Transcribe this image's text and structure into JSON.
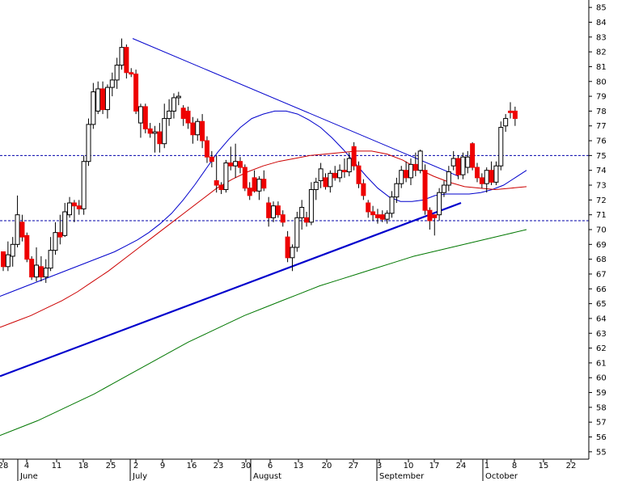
{
  "chart_data": {
    "type": "candlestick",
    "y_axis": {
      "min": 54.5,
      "max": 85.5,
      "ticks": [
        55,
        56,
        57,
        58,
        59,
        60,
        61,
        62,
        63,
        64,
        65,
        66,
        67,
        68,
        69,
        70,
        71,
        72,
        73,
        74,
        75,
        76,
        77,
        78,
        79,
        80,
        81,
        82,
        83,
        84,
        85
      ],
      "position": "right"
    },
    "x_axis": {
      "day_ticks": [
        "28",
        "4",
        "11",
        "18",
        "25",
        "2",
        "9",
        "16",
        "23",
        "30",
        "6",
        "13",
        "20",
        "27",
        "3",
        "10",
        "17",
        "24",
        "1",
        "8",
        "15",
        "22"
      ],
      "months": [
        "June",
        "July",
        "August",
        "September",
        "October"
      ]
    },
    "candles": [
      {
        "o": 68.5,
        "h": 68.5,
        "l": 67.2,
        "c": 67.5,
        "up": false
      },
      {
        "o": 67.5,
        "h": 69.2,
        "l": 67.2,
        "c": 68.3,
        "up": true
      },
      {
        "o": 68.2,
        "h": 69.5,
        "l": 67.5,
        "c": 69.0,
        "up": true
      },
      {
        "o": 69.0,
        "h": 72.3,
        "l": 68.8,
        "c": 71.0,
        "up": true
      },
      {
        "o": 70.5,
        "h": 71.0,
        "l": 69.2,
        "c": 69.5,
        "up": false
      },
      {
        "o": 69.6,
        "h": 69.8,
        "l": 67.8,
        "c": 68.0,
        "up": false
      },
      {
        "o": 68.0,
        "h": 68.2,
        "l": 66.6,
        "c": 66.8,
        "up": false
      },
      {
        "o": 66.8,
        "h": 68.8,
        "l": 66.5,
        "c": 67.6,
        "up": true
      },
      {
        "o": 67.5,
        "h": 68.2,
        "l": 66.5,
        "c": 66.8,
        "up": false
      },
      {
        "o": 66.8,
        "h": 68.0,
        "l": 66.4,
        "c": 67.4,
        "up": true
      },
      {
        "o": 67.4,
        "h": 69.5,
        "l": 67.2,
        "c": 68.6,
        "up": true
      },
      {
        "o": 68.6,
        "h": 70.5,
        "l": 68.3,
        "c": 69.8,
        "up": true
      },
      {
        "o": 69.8,
        "h": 71.0,
        "l": 69.0,
        "c": 69.5,
        "up": false
      },
      {
        "o": 69.6,
        "h": 71.8,
        "l": 69.5,
        "c": 71.2,
        "up": true
      },
      {
        "o": 71.0,
        "h": 72.2,
        "l": 70.8,
        "c": 71.8,
        "up": true
      },
      {
        "o": 71.8,
        "h": 72.0,
        "l": 70.5,
        "c": 71.6,
        "up": false
      },
      {
        "o": 71.6,
        "h": 72.0,
        "l": 71.0,
        "c": 71.4,
        "up": false
      },
      {
        "o": 71.4,
        "h": 75.0,
        "l": 71.0,
        "c": 74.6,
        "up": true
      },
      {
        "o": 74.6,
        "h": 77.5,
        "l": 74.3,
        "c": 77.1,
        "up": true
      },
      {
        "o": 77.1,
        "h": 79.9,
        "l": 76.8,
        "c": 79.3,
        "up": true
      },
      {
        "o": 78.0,
        "h": 80.0,
        "l": 77.8,
        "c": 79.5,
        "up": true
      },
      {
        "o": 79.5,
        "h": 80.0,
        "l": 77.8,
        "c": 78.1,
        "up": false
      },
      {
        "o": 78.1,
        "h": 79.8,
        "l": 77.5,
        "c": 79.6,
        "up": true
      },
      {
        "o": 79.6,
        "h": 80.6,
        "l": 79.0,
        "c": 80.1,
        "up": true
      },
      {
        "o": 80.1,
        "h": 81.6,
        "l": 79.5,
        "c": 81.1,
        "up": true
      },
      {
        "o": 81.1,
        "h": 82.9,
        "l": 80.8,
        "c": 82.3,
        "up": true
      },
      {
        "o": 82.3,
        "h": 82.5,
        "l": 80.2,
        "c": 80.6,
        "up": false
      },
      {
        "o": 80.6,
        "h": 80.9,
        "l": 80.3,
        "c": 80.5,
        "up": false
      },
      {
        "o": 80.5,
        "h": 80.8,
        "l": 77.8,
        "c": 78.0,
        "up": false
      },
      {
        "o": 77.2,
        "h": 78.5,
        "l": 76.2,
        "c": 78.3,
        "up": true
      },
      {
        "o": 78.3,
        "h": 78.5,
        "l": 76.5,
        "c": 76.8,
        "up": false
      },
      {
        "o": 76.8,
        "h": 77.2,
        "l": 76.2,
        "c": 76.5,
        "up": false
      },
      {
        "o": 76.5,
        "h": 77.0,
        "l": 75.2,
        "c": 76.6,
        "up": true
      },
      {
        "o": 76.6,
        "h": 77.2,
        "l": 75.2,
        "c": 75.8,
        "up": false
      },
      {
        "o": 75.8,
        "h": 78.5,
        "l": 75.5,
        "c": 77.5,
        "up": true
      },
      {
        "o": 77.5,
        "h": 78.8,
        "l": 77.0,
        "c": 78.0,
        "up": true
      },
      {
        "o": 78.0,
        "h": 79.2,
        "l": 77.5,
        "c": 78.9,
        "up": true
      },
      {
        "o": 78.9,
        "h": 79.3,
        "l": 78.4,
        "c": 79.0,
        "up": true
      },
      {
        "o": 78.2,
        "h": 78.4,
        "l": 77.0,
        "c": 77.5,
        "up": false
      },
      {
        "o": 78.0,
        "h": 78.3,
        "l": 76.8,
        "c": 77.2,
        "up": false
      },
      {
        "o": 77.2,
        "h": 77.6,
        "l": 75.8,
        "c": 76.4,
        "up": false
      },
      {
        "o": 76.4,
        "h": 77.5,
        "l": 76.0,
        "c": 77.3,
        "up": true
      },
      {
        "o": 77.3,
        "h": 77.8,
        "l": 75.5,
        "c": 76.0,
        "up": false
      },
      {
        "o": 76.0,
        "h": 76.3,
        "l": 74.5,
        "c": 74.9,
        "up": false
      },
      {
        "o": 74.9,
        "h": 75.3,
        "l": 74.2,
        "c": 74.6,
        "up": false
      },
      {
        "o": 73.3,
        "h": 75.0,
        "l": 72.5,
        "c": 73.0,
        "up": false
      },
      {
        "o": 73.0,
        "h": 73.2,
        "l": 72.4,
        "c": 72.7,
        "up": false
      },
      {
        "o": 72.7,
        "h": 74.7,
        "l": 72.5,
        "c": 74.5,
        "up": true
      },
      {
        "o": 74.5,
        "h": 75.6,
        "l": 74.0,
        "c": 74.3,
        "up": false
      },
      {
        "o": 74.3,
        "h": 75.8,
        "l": 73.5,
        "c": 74.6,
        "up": true
      },
      {
        "o": 74.6,
        "h": 74.9,
        "l": 73.8,
        "c": 74.2,
        "up": false
      },
      {
        "o": 74.2,
        "h": 74.4,
        "l": 72.6,
        "c": 72.8,
        "up": false
      },
      {
        "o": 72.8,
        "h": 73.2,
        "l": 72.0,
        "c": 72.3,
        "up": false
      },
      {
        "o": 73.5,
        "h": 74.0,
        "l": 72.5,
        "c": 72.6,
        "up": false
      },
      {
        "o": 72.6,
        "h": 73.6,
        "l": 72.0,
        "c": 73.4,
        "up": true
      },
      {
        "o": 73.4,
        "h": 74.0,
        "l": 72.6,
        "c": 72.8,
        "up": false
      },
      {
        "o": 71.8,
        "h": 72.2,
        "l": 70.2,
        "c": 70.8,
        "up": false
      },
      {
        "o": 70.8,
        "h": 71.9,
        "l": 70.5,
        "c": 71.6,
        "up": true
      },
      {
        "o": 71.6,
        "h": 71.9,
        "l": 70.8,
        "c": 71.0,
        "up": false
      },
      {
        "o": 71.0,
        "h": 71.3,
        "l": 70.2,
        "c": 70.5,
        "up": false
      },
      {
        "o": 69.5,
        "h": 69.9,
        "l": 67.8,
        "c": 68.1,
        "up": false
      },
      {
        "o": 68.1,
        "h": 69.0,
        "l": 67.2,
        "c": 68.8,
        "up": true
      },
      {
        "o": 68.8,
        "h": 71.2,
        "l": 68.5,
        "c": 70.8,
        "up": true
      },
      {
        "o": 70.8,
        "h": 72.0,
        "l": 70.0,
        "c": 71.5,
        "up": true
      },
      {
        "o": 70.8,
        "h": 71.2,
        "l": 70.2,
        "c": 70.5,
        "up": false
      },
      {
        "o": 70.5,
        "h": 73.2,
        "l": 70.3,
        "c": 72.7,
        "up": true
      },
      {
        "o": 72.7,
        "h": 73.5,
        "l": 72.0,
        "c": 73.2,
        "up": true
      },
      {
        "o": 73.3,
        "h": 74.5,
        "l": 72.8,
        "c": 74.1,
        "up": true
      },
      {
        "o": 73.5,
        "h": 73.8,
        "l": 72.7,
        "c": 72.9,
        "up": false
      },
      {
        "o": 72.9,
        "h": 74.0,
        "l": 72.5,
        "c": 73.8,
        "up": true
      },
      {
        "o": 73.8,
        "h": 74.3,
        "l": 73.3,
        "c": 73.5,
        "up": false
      },
      {
        "o": 73.5,
        "h": 74.4,
        "l": 73.2,
        "c": 74.0,
        "up": true
      },
      {
        "o": 74.0,
        "h": 74.8,
        "l": 73.5,
        "c": 73.9,
        "up": false
      },
      {
        "o": 73.9,
        "h": 75.2,
        "l": 73.6,
        "c": 74.8,
        "up": true
      },
      {
        "o": 75.6,
        "h": 75.9,
        "l": 74.0,
        "c": 74.3,
        "up": false
      },
      {
        "o": 74.3,
        "h": 74.6,
        "l": 72.8,
        "c": 73.1,
        "up": false
      },
      {
        "o": 73.1,
        "h": 73.4,
        "l": 72.0,
        "c": 72.3,
        "up": false
      },
      {
        "o": 71.8,
        "h": 72.0,
        "l": 70.8,
        "c": 71.2,
        "up": false
      },
      {
        "o": 71.2,
        "h": 71.6,
        "l": 70.6,
        "c": 71.0,
        "up": false
      },
      {
        "o": 71.0,
        "h": 71.4,
        "l": 70.4,
        "c": 70.8,
        "up": false
      },
      {
        "o": 71.0,
        "h": 71.3,
        "l": 70.5,
        "c": 70.7,
        "up": false
      },
      {
        "o": 70.7,
        "h": 71.3,
        "l": 70.4,
        "c": 71.1,
        "up": true
      },
      {
        "o": 71.1,
        "h": 72.6,
        "l": 70.8,
        "c": 72.2,
        "up": true
      },
      {
        "o": 72.2,
        "h": 73.5,
        "l": 71.8,
        "c": 73.1,
        "up": true
      },
      {
        "o": 73.1,
        "h": 74.3,
        "l": 72.8,
        "c": 74.0,
        "up": true
      },
      {
        "o": 74.0,
        "h": 74.6,
        "l": 73.2,
        "c": 73.5,
        "up": false
      },
      {
        "o": 73.5,
        "h": 74.8,
        "l": 73.0,
        "c": 74.4,
        "up": true
      },
      {
        "o": 74.4,
        "h": 75.2,
        "l": 73.6,
        "c": 74.0,
        "up": false
      },
      {
        "o": 74.0,
        "h": 75.4,
        "l": 73.8,
        "c": 75.3,
        "up": true
      },
      {
        "o": 74.0,
        "h": 74.4,
        "l": 71.0,
        "c": 71.3,
        "up": false
      },
      {
        "o": 71.3,
        "h": 71.5,
        "l": 70.0,
        "c": 70.6,
        "up": false
      },
      {
        "o": 70.8,
        "h": 71.0,
        "l": 69.6,
        "c": 71.0,
        "up": false
      },
      {
        "o": 71.0,
        "h": 72.8,
        "l": 70.6,
        "c": 72.5,
        "up": true
      },
      {
        "o": 72.5,
        "h": 73.3,
        "l": 72.2,
        "c": 73.0,
        "up": true
      },
      {
        "o": 73.0,
        "h": 74.3,
        "l": 72.6,
        "c": 73.9,
        "up": true
      },
      {
        "o": 74.3,
        "h": 75.3,
        "l": 74.0,
        "c": 74.8,
        "up": true
      },
      {
        "o": 74.8,
        "h": 75.0,
        "l": 73.4,
        "c": 73.7,
        "up": false
      },
      {
        "o": 73.7,
        "h": 75.2,
        "l": 73.4,
        "c": 74.9,
        "up": true
      },
      {
        "o": 74.9,
        "h": 75.3,
        "l": 73.8,
        "c": 74.2,
        "up": true
      },
      {
        "o": 75.8,
        "h": 75.9,
        "l": 74.0,
        "c": 74.2,
        "up": false
      },
      {
        "o": 74.2,
        "h": 74.5,
        "l": 73.2,
        "c": 73.5,
        "up": false
      },
      {
        "o": 73.5,
        "h": 73.8,
        "l": 72.8,
        "c": 73.1,
        "up": false
      },
      {
        "o": 73.1,
        "h": 74.2,
        "l": 72.5,
        "c": 74.0,
        "up": true
      },
      {
        "o": 74.0,
        "h": 74.6,
        "l": 73.0,
        "c": 73.2,
        "up": false
      },
      {
        "o": 73.2,
        "h": 74.6,
        "l": 73.0,
        "c": 74.3,
        "up": true
      },
      {
        "o": 74.3,
        "h": 77.3,
        "l": 74.0,
        "c": 76.9,
        "up": true
      },
      {
        "o": 77.0,
        "h": 77.8,
        "l": 76.6,
        "c": 77.5,
        "up": true
      },
      {
        "o": 77.9,
        "h": 78.6,
        "l": 77.5,
        "c": 78.0,
        "up": false
      },
      {
        "o": 78.0,
        "h": 78.3,
        "l": 77.0,
        "c": 77.5,
        "up": false
      }
    ],
    "moving_averages": [
      {
        "color": "#0000cc",
        "values": [
          65.5,
          65.8,
          66.1,
          66.4,
          66.7,
          67.0,
          67.3,
          67.6,
          67.9,
          68.2,
          68.5,
          68.9,
          69.3,
          69.8,
          70.4,
          71.1,
          72.0,
          73.0,
          74.1,
          75.2,
          76.1,
          76.9,
          77.5,
          77.8,
          78.0,
          78.0,
          77.8,
          77.4,
          76.9,
          76.2,
          75.4,
          74.5,
          73.6,
          72.8,
          72.2,
          71.9,
          71.9,
          72.0,
          72.3,
          72.4,
          72.4,
          72.4,
          72.5,
          72.7,
          73.0,
          73.5,
          74.0
        ]
      },
      {
        "color": "#cc0000",
        "values": [
          63.4,
          63.8,
          64.2,
          64.7,
          65.2,
          65.8,
          66.5,
          67.2,
          68.0,
          68.8,
          69.6,
          70.4,
          71.2,
          72.0,
          72.8,
          73.4,
          73.9,
          74.3,
          74.6,
          74.8,
          75.0,
          75.1,
          75.2,
          75.3,
          75.3,
          75.1,
          74.7,
          74.1,
          73.6,
          73.2,
          72.9,
          72.8,
          72.7,
          72.8,
          72.9
        ]
      },
      {
        "color": "#007700",
        "values": [
          56.1,
          56.6,
          57.1,
          57.7,
          58.3,
          58.9,
          59.6,
          60.3,
          61.0,
          61.7,
          62.4,
          63.0,
          63.6,
          64.2,
          64.7,
          65.2,
          65.7,
          66.2,
          66.6,
          67.0,
          67.4,
          67.8,
          68.2,
          68.5,
          68.8,
          69.1,
          69.4,
          69.7,
          70.0
        ]
      }
    ],
    "trendlines": [
      {
        "color": "#0000cc",
        "points": [
          [
            164,
            82.9
          ],
          [
            567,
            73.6
          ]
        ],
        "width": 1
      },
      {
        "color": "#0000cc",
        "points": [
          [
            0,
            60.1
          ],
          [
            570,
            71.8
          ]
        ],
        "width": 2.2
      }
    ],
    "h_lines": [
      75.0,
      70.6
    ]
  }
}
